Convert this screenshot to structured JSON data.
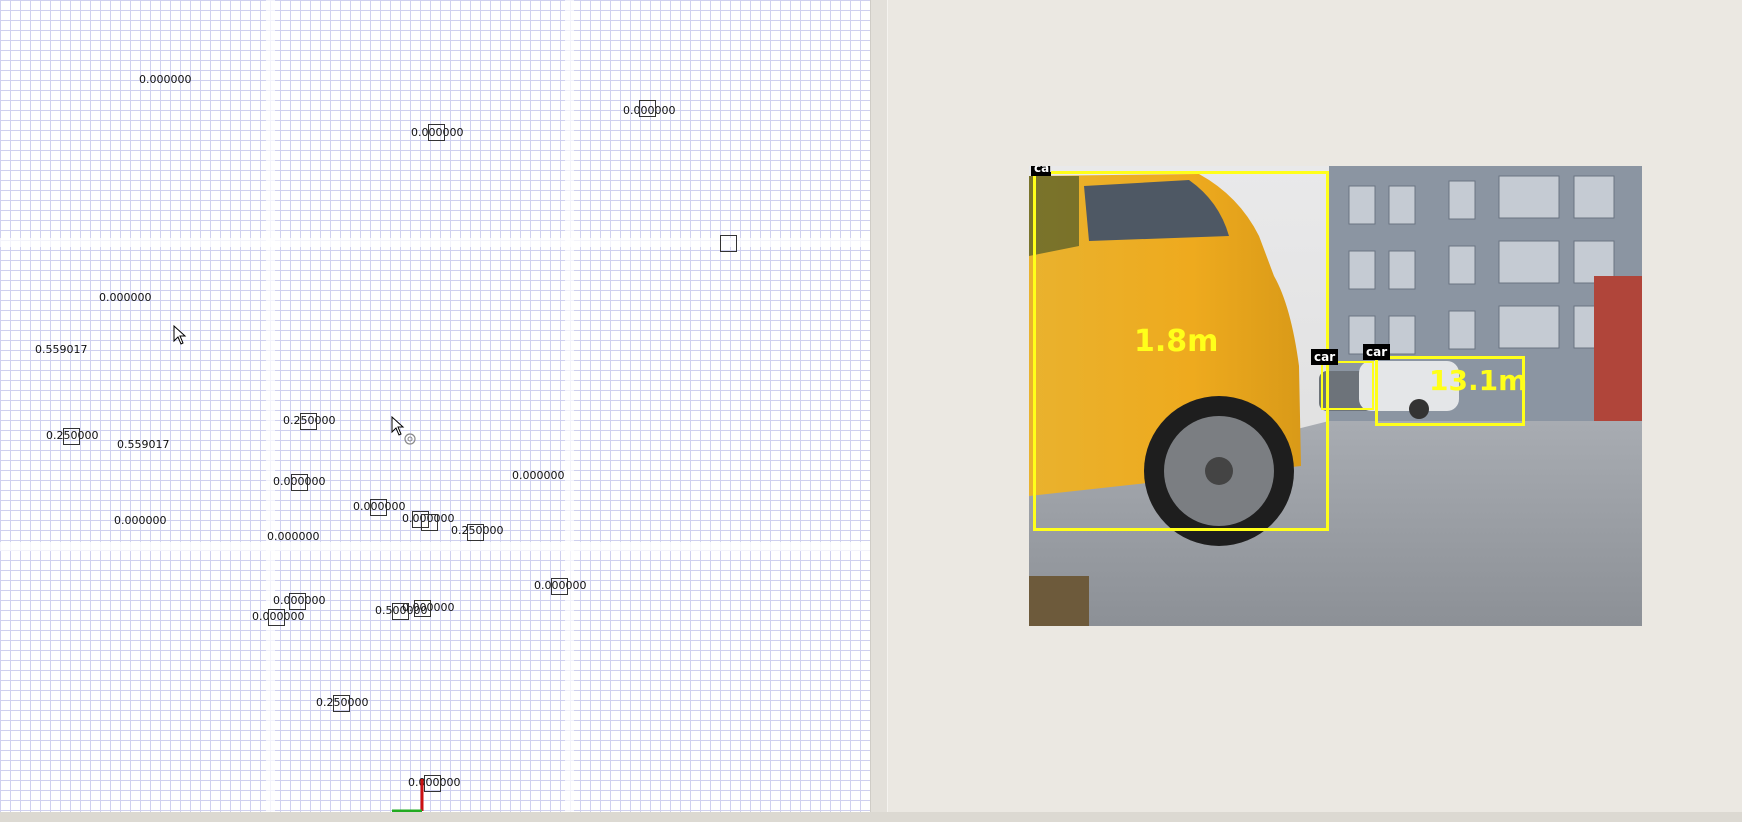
{
  "grid_view": {
    "labels": [
      {
        "text": "0.000000"
      },
      {
        "text": "0.000000"
      },
      {
        "text": "0.000000"
      },
      {
        "text": "0.000000"
      },
      {
        "text": "0.559017"
      },
      {
        "text": "0.250000"
      },
      {
        "text": "0.559017"
      },
      {
        "text": "0.250000"
      },
      {
        "text": "0.000000"
      },
      {
        "text": "0.000000"
      },
      {
        "text": "0.000000"
      },
      {
        "text": "0.000000"
      },
      {
        "text": "0.000000"
      },
      {
        "text": "0.000000"
      },
      {
        "text": "0.250000"
      },
      {
        "text": "0.000000"
      },
      {
        "text": "0.000000"
      },
      {
        "text": "0.000000"
      },
      {
        "text": "0.500000"
      },
      {
        "text": "0.000000"
      },
      {
        "text": "0.250000"
      },
      {
        "text": "0.000000"
      }
    ]
  },
  "camera": {
    "detections": [
      {
        "class": "car",
        "distance": "1.8m"
      },
      {
        "class": "car",
        "distance": ""
      },
      {
        "class": "car",
        "distance": "13.1m"
      }
    ],
    "partial_tag": "car"
  },
  "colors": {
    "bbox": "#ffff1a",
    "grid_line": "#cfd0ef",
    "axis_x": "#cc1111",
    "axis_y": "#22aa22"
  }
}
